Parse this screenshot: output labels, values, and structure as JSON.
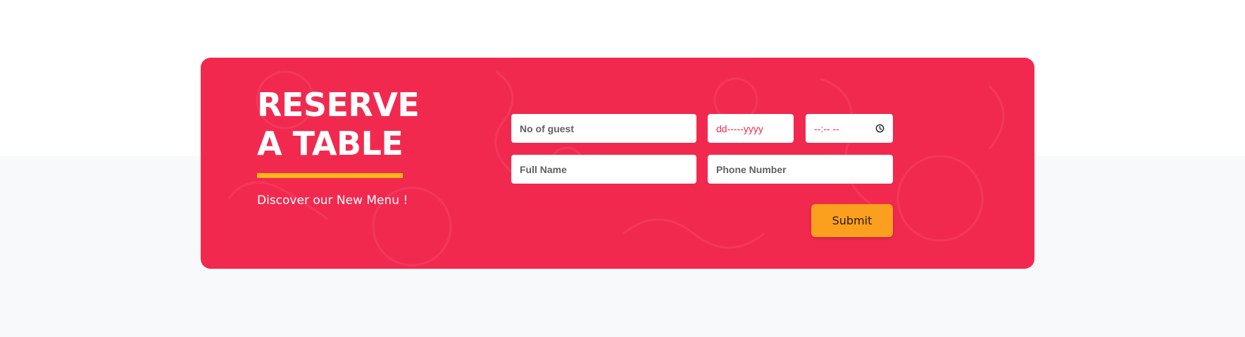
{
  "reservation": {
    "title_line1": "RESERVE",
    "title_line2": "A TABLE",
    "subtitle": "Discover our New Menu !",
    "fields": {
      "guests_placeholder": "No of guest",
      "date_placeholder": "dd-----yyyy",
      "time_placeholder": "--:-- --",
      "fullname_placeholder": "Full Name",
      "phone_placeholder": "Phone Number"
    },
    "submit_label": "Submit"
  },
  "colors": {
    "card_bg": "#f2294f",
    "accent_underline": "#fbb719",
    "submit_bg": "#fb9f1e",
    "page_bg_bottom": "#f8f9fb"
  },
  "icons": {
    "time_icon": "clock-icon"
  }
}
